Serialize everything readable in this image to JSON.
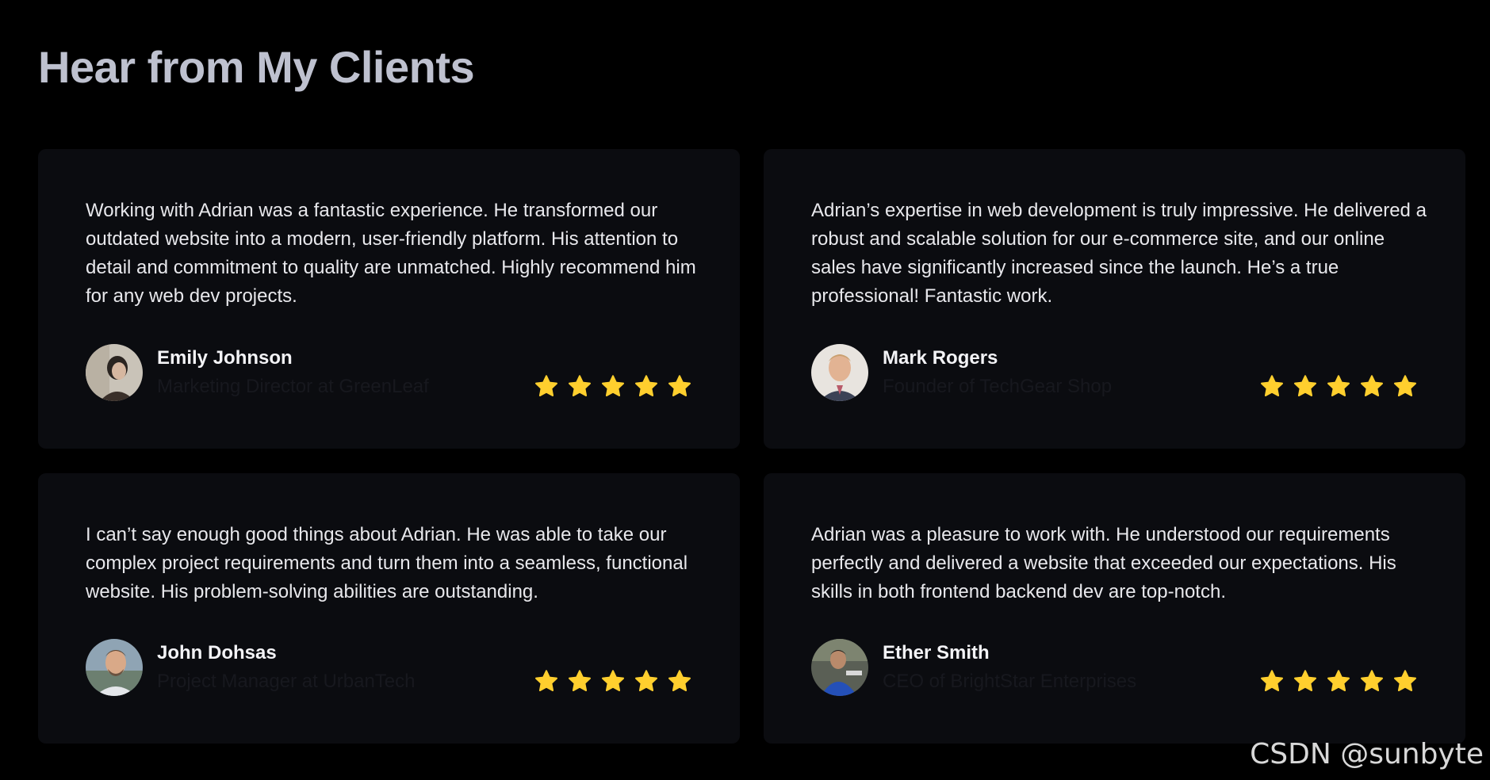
{
  "page": {
    "title": "Hear from My Clients"
  },
  "colors": {
    "background": "#000000",
    "card": "#0B0C10",
    "title": "#BEC1CF",
    "quote_text": "#E8E8EC",
    "name_text": "#F3F3F6",
    "role_text": "#17181E",
    "star": "#FFCF2E"
  },
  "testimonials": [
    {
      "quote": "Working with Adrian was a fantastic experience. He transformed our outdated website into a modern, user-friendly platform. His attention to detail and commitment to quality are unmatched. Highly recommend him for any web dev projects.",
      "name": "Emily Johnson",
      "role": "Marketing Director at GreenLeaf",
      "rating": 5,
      "avatar_icon": "avatar-photo"
    },
    {
      "quote": "Adrian’s expertise in web development is truly impressive. He delivered a robust and scalable solution for our e-commerce site, and our online sales have significantly increased since the launch. He’s a true professional! Fantastic work.",
      "name": "Mark Rogers",
      "role": "Founder of TechGear Shop",
      "rating": 5,
      "avatar_icon": "avatar-photo"
    },
    {
      "quote": "I can’t say enough good things about Adrian. He was able to take our complex project requirements and turn them into a seamless, functional website. His problem-solving abilities are outstanding.",
      "name": "John Dohsas",
      "role": "Project Manager at UrbanTech",
      "rating": 5,
      "avatar_icon": "avatar-photo"
    },
    {
      "quote": "Adrian was a pleasure to work with. He understood our requirements perfectly and delivered a website that exceeded our expectations. His skills in both frontend backend dev are top-notch.",
      "name": "Ether Smith",
      "role": "CEO of BrightStar Enterprises",
      "rating": 5,
      "avatar_icon": "avatar-photo"
    }
  ],
  "watermark": "CSDN @sunbyte"
}
